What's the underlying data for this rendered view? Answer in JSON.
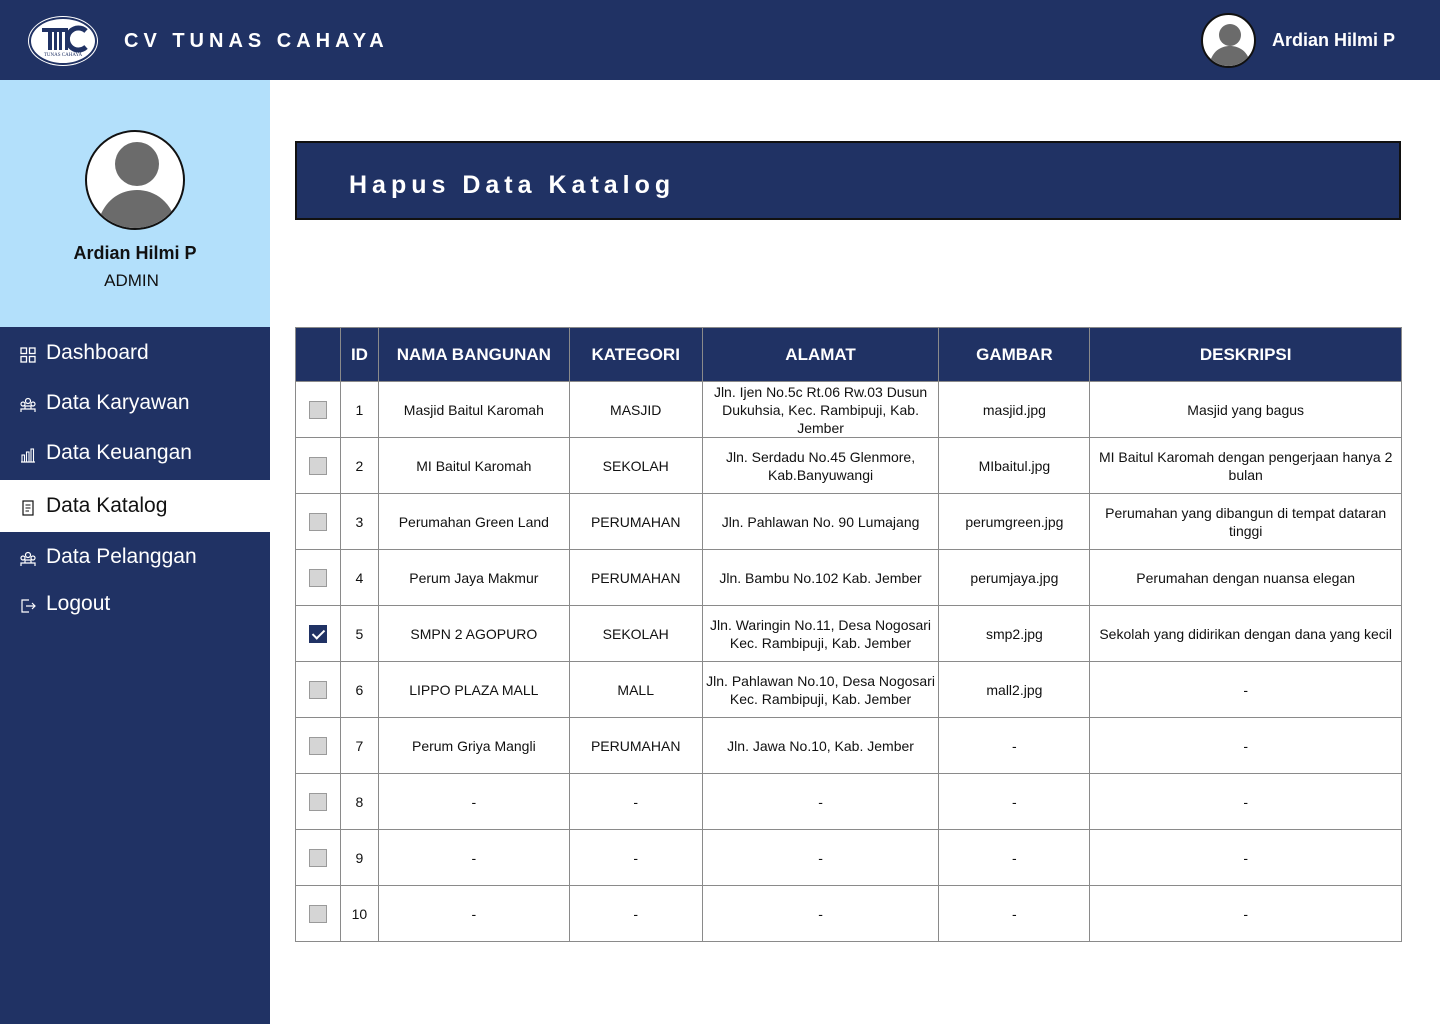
{
  "header": {
    "brand": "CV TUNAS CAHAYA",
    "logo_text": "TUNAS CAHAYA",
    "user_name": "Ardian Hilmi P"
  },
  "profile": {
    "name": "Ardian Hilmi P",
    "role": "ADMIN"
  },
  "nav": [
    {
      "label": "Dashboard",
      "icon": "grid-icon"
    },
    {
      "label": "Data Karyawan",
      "icon": "users-icon"
    },
    {
      "label": "Data Keuangan",
      "icon": "bar-chart-icon"
    },
    {
      "label": "Data Katalog",
      "icon": "document-icon",
      "active": true
    },
    {
      "label": "Data Pelanggan",
      "icon": "users-icon"
    },
    {
      "label": "Logout",
      "icon": "logout-icon"
    }
  ],
  "page": {
    "title": "Hapus Data Katalog"
  },
  "table": {
    "columns": [
      "",
      "ID",
      "NAMA BANGUNAN",
      "KATEGORI",
      "ALAMAT",
      "GAMBAR",
      "DESKRIPSI"
    ],
    "rows": [
      {
        "checked": false,
        "id": "1",
        "nama": "Masjid Baitul Karomah",
        "kategori": "MASJID",
        "alamat": "Jln. Ijen No.5c Rt.06 Rw.03 Dusun Dukuhsia, Kec. Rambipuji, Kab. Jember",
        "gambar": "masjid.jpg",
        "deskripsi": "Masjid yang bagus"
      },
      {
        "checked": false,
        "id": "2",
        "nama": "MI Baitul Karomah",
        "kategori": "SEKOLAH",
        "alamat": "Jln. Serdadu No.45 Glenmore, Kab.Banyuwangi",
        "gambar": "MIbaitul.jpg",
        "deskripsi": "MI Baitul Karomah dengan pengerjaan hanya 2 bulan"
      },
      {
        "checked": false,
        "id": "3",
        "nama": "Perumahan Green Land",
        "kategori": "PERUMAHAN",
        "alamat": "Jln. Pahlawan No. 90 Lumajang",
        "gambar": "perumgreen.jpg",
        "deskripsi": "Perumahan yang dibangun di tempat dataran tinggi"
      },
      {
        "checked": false,
        "id": "4",
        "nama": "Perum Jaya Makmur",
        "kategori": "PERUMAHAN",
        "alamat": "Jln. Bambu No.102 Kab. Jember",
        "gambar": "perumjaya.jpg",
        "deskripsi": "Perumahan dengan nuansa elegan"
      },
      {
        "checked": true,
        "id": "5",
        "nama": "SMPN 2 AGOPURO",
        "kategori": "SEKOLAH",
        "alamat": "Jln. Waringin No.11, Desa Nogosari Kec. Rambipuji, Kab. Jember",
        "gambar": "smp2.jpg",
        "deskripsi": "Sekolah yang didirikan dengan dana yang kecil"
      },
      {
        "checked": false,
        "id": "6",
        "nama": "LIPPO PLAZA MALL",
        "kategori": "MALL",
        "alamat": "Jln. Pahlawan No.10, Desa Nogosari Kec. Rambipuji, Kab. Jember",
        "gambar": "mall2.jpg",
        "deskripsi": "-"
      },
      {
        "checked": false,
        "id": "7",
        "nama": "Perum Griya Mangli",
        "kategori": "PERUMAHAN",
        "alamat": "Jln. Jawa No.10, Kab. Jember",
        "gambar": "-",
        "deskripsi": "-"
      },
      {
        "checked": false,
        "id": "8",
        "nama": "-",
        "kategori": "-",
        "alamat": "-",
        "gambar": "-",
        "deskripsi": "-"
      },
      {
        "checked": false,
        "id": "9",
        "nama": "-",
        "kategori": "-",
        "alamat": "-",
        "gambar": "-",
        "deskripsi": "-"
      },
      {
        "checked": false,
        "id": "10",
        "nama": "-",
        "kategori": "-",
        "alamat": "-",
        "gambar": "-",
        "deskripsi": "-"
      }
    ]
  },
  "colors": {
    "primary": "#203264",
    "sidebar_profile": "#b3e0fb",
    "checkbox": "#d5d5d5"
  }
}
